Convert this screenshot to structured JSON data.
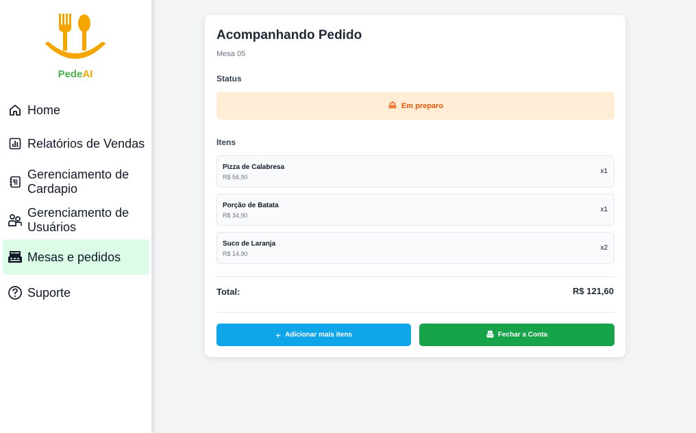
{
  "brand": {
    "name_part1": "Pede",
    "name_part2": "AI",
    "logo_icon": "fork-spoon-smile-icon"
  },
  "sidebar": {
    "items": [
      {
        "label": "Home",
        "icon": "home-icon"
      },
      {
        "label": "Relatórios de Vendas",
        "icon": "chart-icon"
      },
      {
        "label": "Gerenciamento de Cardapio",
        "icon": "menu-book-icon"
      },
      {
        "label": "Gerenciamento de Usuários",
        "icon": "users-icon"
      },
      {
        "label": "Mesas e pedidos",
        "icon": "cash-register-icon",
        "active": true
      },
      {
        "label": "Suporte",
        "icon": "help-icon"
      }
    ]
  },
  "order": {
    "title": "Acompanhando Pedido",
    "table": "Mesa 05",
    "status_label": "Status",
    "status_value": "Em preparo",
    "items_label": "Itens",
    "items": [
      {
        "name": "Pizza de Calabresa",
        "price": "R$ 56,90",
        "qty": "x1"
      },
      {
        "name": "Porção de Batata",
        "price": "R$ 34,90",
        "qty": "x1"
      },
      {
        "name": "Suco de Laranja",
        "price": "R$ 14,90",
        "qty": "x2"
      }
    ],
    "total_label": "Total:",
    "total_value": "R$ 121,60",
    "add_button": "Adicionar mais itens",
    "close_button": "Fechar a Conta"
  },
  "colors": {
    "brand_green": "#4caf50",
    "brand_orange": "#f5a500",
    "active_nav": "#dcfce7",
    "status_bg": "#ffedd5",
    "status_text": "#ea580c",
    "add_button": "#0ea5e9",
    "close_button": "#16a34a"
  }
}
